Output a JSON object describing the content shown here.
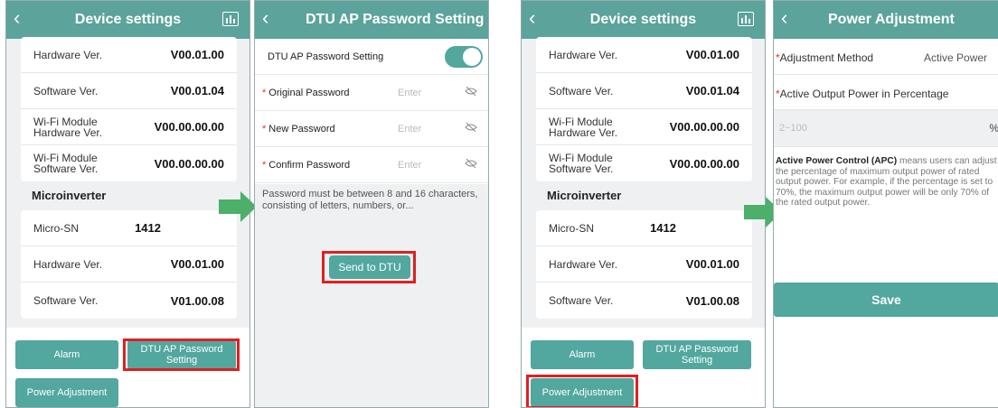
{
  "screen1": {
    "header": {
      "title": "Device settings"
    },
    "dtu_rows": [
      {
        "label": "Hardware Ver.",
        "value": "V00.01.00"
      },
      {
        "label": "Software Ver.",
        "value": "V00.01.04"
      },
      {
        "label": "Wi-Fi Module Hardware Ver.",
        "value": "V00.00.00.00"
      },
      {
        "label": "Wi-Fi Module Software Ver.",
        "value": "V00.00.00.00"
      }
    ],
    "micro_title": "Microinverter",
    "micro_rows": [
      {
        "label": "Micro-SN",
        "value": "1412"
      },
      {
        "label": "Hardware Ver.",
        "value": "V00.01.00"
      },
      {
        "label": "Software Ver.",
        "value": "V01.00.08"
      }
    ],
    "buttons": {
      "alarm": "Alarm",
      "dtu_ap": "DTU AP Password Setting",
      "power": "Power Adjustment"
    }
  },
  "screen2": {
    "header": {
      "title": "DTU AP Password Setting"
    },
    "toggle_label": "DTU AP Password Setting",
    "toggle_on": true,
    "fields": [
      {
        "label": "Original Password",
        "placeholder": "Enter"
      },
      {
        "label": "New Password",
        "placeholder": "Enter"
      },
      {
        "label": "Confirm Password",
        "placeholder": "Enter"
      }
    ],
    "hint": "Password must be between 8 and 16 characters, consisting of letters, numbers, or...",
    "send_button": "Send to DTU"
  },
  "screen4": {
    "header": {
      "title": "Power Adjustment"
    },
    "method_label": "Adjustment Method",
    "method_value": "Active Power",
    "output_label": "Active Output Power in Percentage",
    "input_placeholder": "2~100",
    "unit": "%",
    "desc_bold": "Active Power Control (APC)",
    "desc_text": " means users can adjust the percentage of maximum output power of rated output power. For example, if the percentage is set to 70%, the maximum output power will be only 70% of the rated output power.",
    "save_button": "Save"
  },
  "colors": {
    "accent": "#5ba39b",
    "highlight": "#e02020",
    "arrow": "#4caf6a"
  },
  "icons": [
    "back-chevron-icon",
    "chart-icon",
    "eye-off-icon",
    "arrow-right-icon"
  ]
}
